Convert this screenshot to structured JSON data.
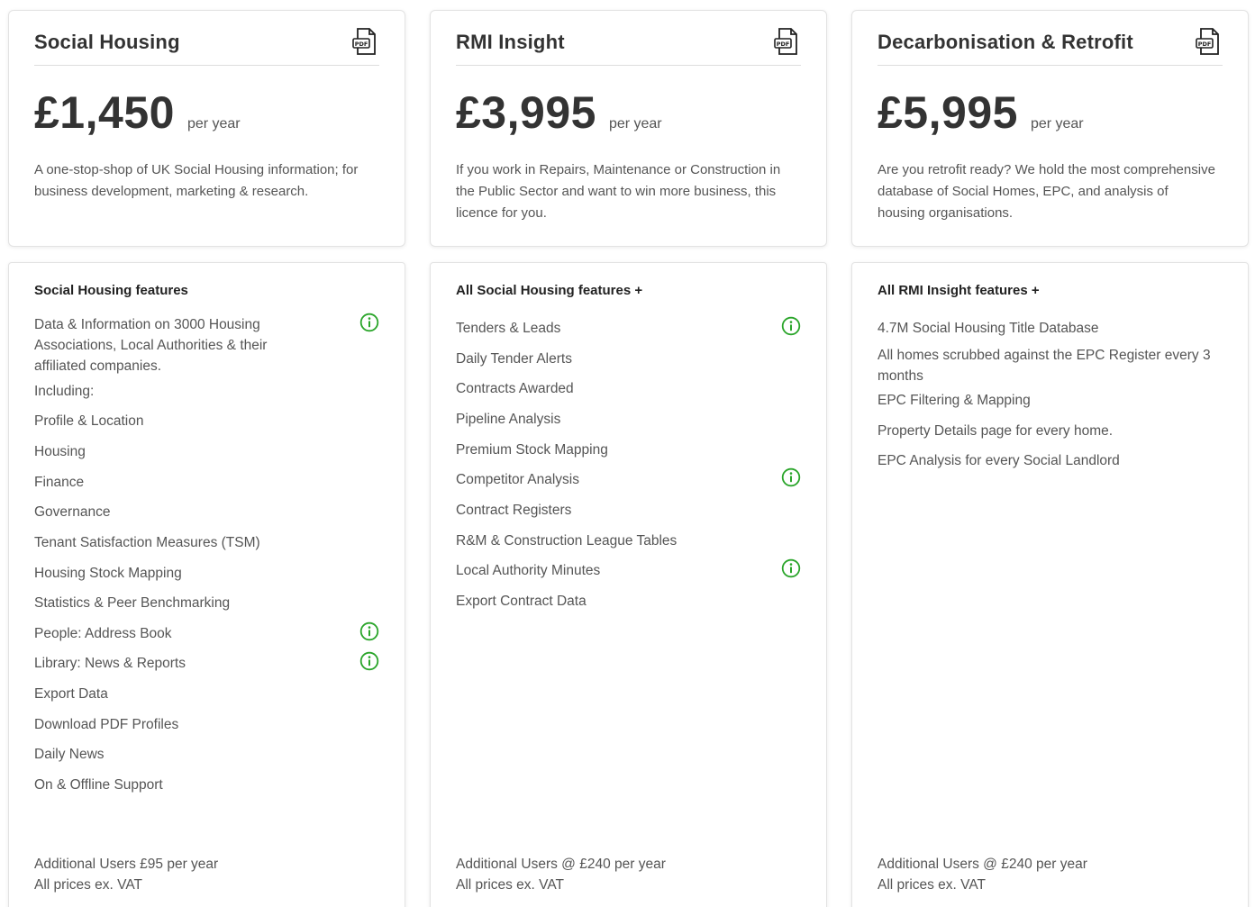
{
  "plans": [
    {
      "title": "Social Housing",
      "price": "£1,450",
      "period": "per year",
      "description": "A one-stop-shop of UK Social Housing information; for business development, marketing & research.",
      "features_heading": "Social Housing features",
      "features": [
        {
          "text": "Data & Information on 3000 Housing Associations, Local Authorities & their affiliated companies.",
          "info": true
        },
        {
          "text": "Including:",
          "info": false
        },
        {
          "text": "Profile & Location",
          "info": false
        },
        {
          "text": "Housing",
          "info": false
        },
        {
          "text": "Finance",
          "info": false
        },
        {
          "text": "Governance",
          "info": false
        },
        {
          "text": "Tenant Satisfaction Measures (TSM)",
          "info": false
        },
        {
          "text": "Housing Stock Mapping",
          "info": false
        },
        {
          "text": "Statistics & Peer Benchmarking",
          "info": false
        },
        {
          "text": "People: Address Book",
          "info": true
        },
        {
          "text": "Library: News & Reports",
          "info": true
        },
        {
          "text": "Export Data",
          "info": false
        },
        {
          "text": "Download PDF Profiles",
          "info": false
        },
        {
          "text": "Daily News",
          "info": false
        },
        {
          "text": "On & Offline Support",
          "info": false
        }
      ],
      "footer_users": "Additional Users £95 per year",
      "footer_vat": "All prices ex. VAT"
    },
    {
      "title": "RMI Insight",
      "price": "£3,995",
      "period": "per year",
      "description": "If you work in Repairs, Maintenance or Construction in the Public Sector and want to win more business, this licence for you.",
      "features_heading": "All Social Housing features +",
      "features": [
        {
          "text": "Tenders & Leads",
          "info": true
        },
        {
          "text": "Daily Tender Alerts",
          "info": false
        },
        {
          "text": "Contracts Awarded",
          "info": false
        },
        {
          "text": "Pipeline Analysis",
          "info": false
        },
        {
          "text": "Premium Stock Mapping",
          "info": false
        },
        {
          "text": "Competitor Analysis",
          "info": true
        },
        {
          "text": "Contract Registers",
          "info": false
        },
        {
          "text": "R&M & Construction League Tables",
          "info": false
        },
        {
          "text": "Local Authority Minutes",
          "info": true
        },
        {
          "text": "Export Contract Data",
          "info": false
        }
      ],
      "footer_users": "Additional Users @ £240 per year",
      "footer_vat": "All prices ex. VAT"
    },
    {
      "title": "Decarbonisation & Retrofit",
      "price": "£5,995",
      "period": "per year",
      "description": "Are you retrofit ready? We hold the most comprehensive database of Social Homes, EPC, and analysis of housing organisations.",
      "features_heading": "All RMI Insight features +",
      "features": [
        {
          "text": "4.7M Social Housing Title Database",
          "info": false
        },
        {
          "text": "All homes scrubbed against the EPC Register every 3 months",
          "info": false
        },
        {
          "text": "EPC Filtering & Mapping",
          "info": false
        },
        {
          "text": "Property Details page for every home.",
          "info": false
        },
        {
          "text": "EPC Analysis for every Social Landlord",
          "info": false
        }
      ],
      "footer_users": "Additional Users @ £240 per year",
      "footer_vat": "All prices ex. VAT"
    }
  ],
  "icons": {
    "pdf": "pdf-icon",
    "info": "info-icon"
  },
  "colors": {
    "info_green": "#2aa52a",
    "text_dark": "#333333",
    "text_body": "#555555"
  }
}
